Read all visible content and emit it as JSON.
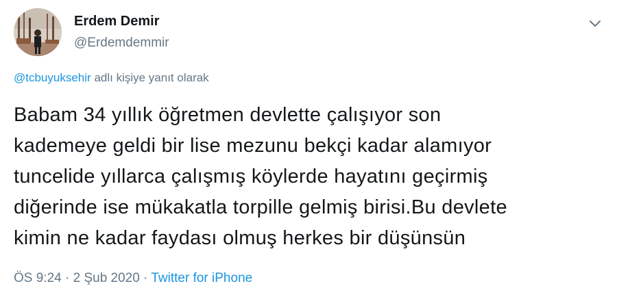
{
  "author": {
    "display_name": "Erdem Demir",
    "handle": "@Erdemdemmir"
  },
  "icons": {
    "menu": "chevron-down-icon",
    "avatar": "profile-photo"
  },
  "reply": {
    "mention": "@tcbuyuksehir",
    "suffix": "adlı kişiye yanıt olarak"
  },
  "tweet": {
    "lines": [
      "Babam 34 yıllık öğretmen devlette çalışıyor son",
      "kademeye geldi bir lise mezunu bekçi kadar alamıyor",
      "tuncelide yıllarca çalışmış köylerde hayatını geçirmiş",
      "diğerinde ise mükakatla torpille gelmiş birisi.Bu devlete",
      "kimin ne kadar faydası olmuş herkes bir düşünsün"
    ]
  },
  "meta": {
    "time": "ÖS 9:24",
    "separator": "·",
    "date": "2 Şub 2020",
    "source": "Twitter for iPhone"
  },
  "colors": {
    "text": "#14171a",
    "secondary": "#657786",
    "link": "#1b95e0"
  }
}
